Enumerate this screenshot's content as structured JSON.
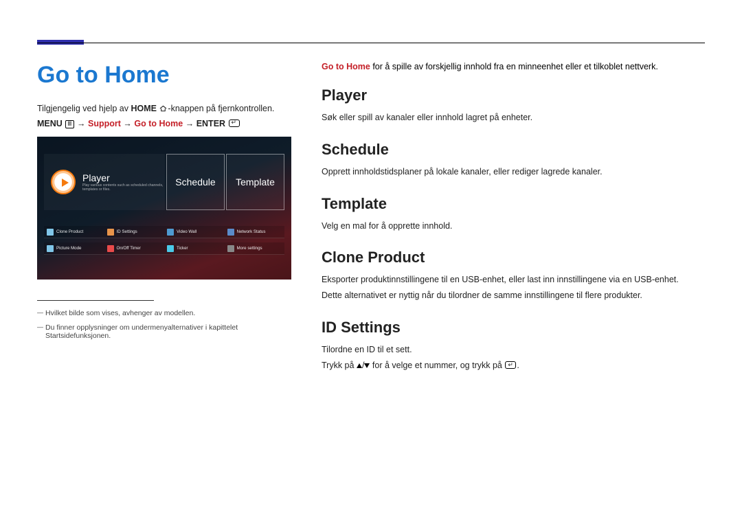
{
  "pageTitle": "Go to Home",
  "intro": {
    "pre": "Tilgjengelig ved hjelp av ",
    "boldHome": "HOME",
    "post": "-knappen på fjernkontrollen."
  },
  "path": {
    "menu": "MENU",
    "support": "Support",
    "gotoHome": "Go to Home",
    "enter": "ENTER",
    "arrow": "→"
  },
  "uiShot": {
    "row1": {
      "player": "Player",
      "playerSub": "Play various contents such as scheduled channels, templates or files.",
      "schedule": "Schedule",
      "template": "Template"
    },
    "chips": [
      "Clone Product",
      "ID Settings",
      "Video Wall",
      "Network Status",
      "Picture Mode",
      "On/Off Timer",
      "Ticker",
      "More settings"
    ]
  },
  "footnotes": [
    "Hvilket bilde som vises, avhenger av modellen.",
    "Du finner opplysninger om undermenyalternativer i kapittelet Startsidefunksjonen."
  ],
  "rightIntro": {
    "red": "Go to Home",
    "rest": " for å spille av forskjellig innhold fra en minneenhet eller et tilkoblet nettverk."
  },
  "sections": {
    "player": {
      "h": "Player",
      "p": "Søk eller spill av kanaler eller innhold lagret på enheter."
    },
    "schedule": {
      "h": "Schedule",
      "p": "Opprett innholdstidsplaner på lokale kanaler, eller rediger lagrede kanaler."
    },
    "template": {
      "h": "Template",
      "p": "Velg en mal for å opprette innhold."
    },
    "clone": {
      "h": "Clone Product",
      "p1": "Eksporter produktinnstillingene til en USB-enhet, eller last inn innstillingene via en USB-enhet.",
      "p2": "Dette alternativet er nyttig når du tilordner de samme innstillingene til flere produkter."
    },
    "idsettings": {
      "h": "ID Settings",
      "p1": "Tilordne en ID til et sett.",
      "p2pre": "Trykk på ",
      "p2mid": " for å velge et nummer, og trykk på ",
      "p2post": "."
    }
  }
}
